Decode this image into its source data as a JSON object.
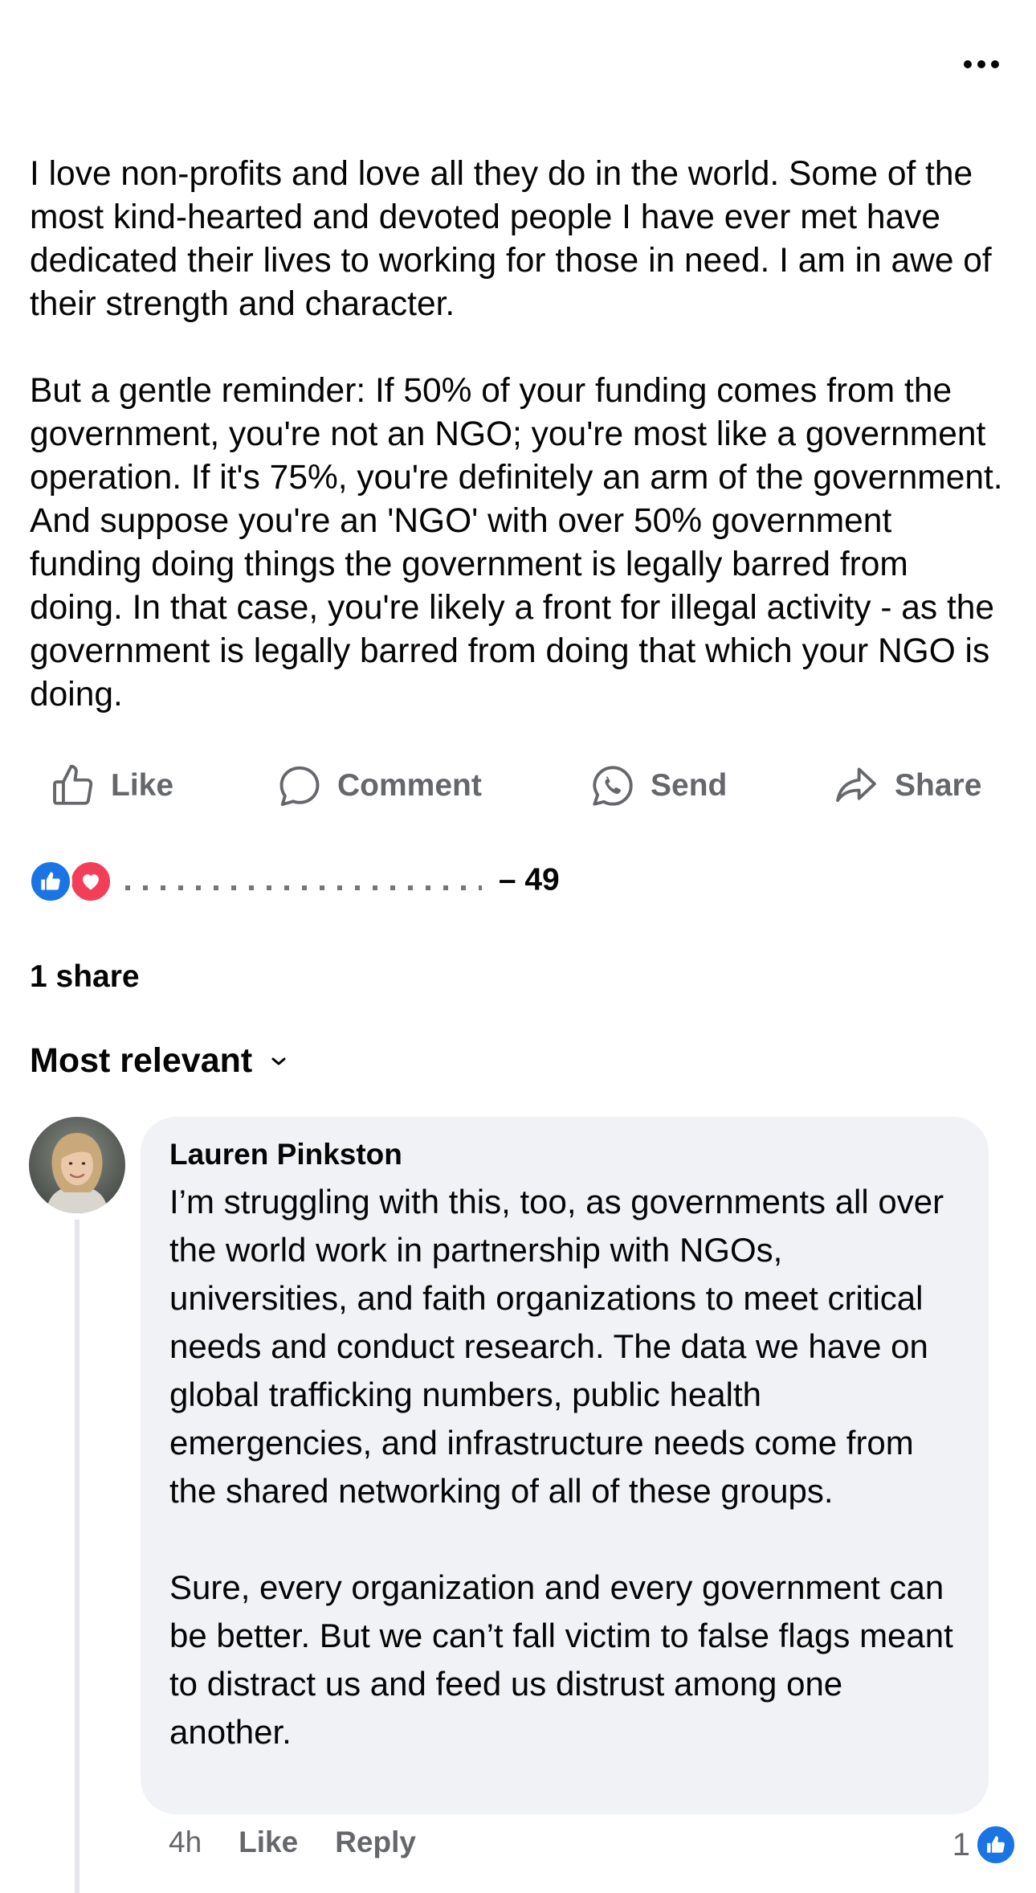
{
  "post": {
    "paragraphs": [
      "I love non-profits and love all they do in the world. Some of the most kind-hearted and devoted people I have ever met have dedicated their lives to working for those in need. I am in awe of their strength and character.",
      "But a gentle reminder: If 50% of your funding comes from the government, you're not an NGO; you're most like a government operation. If it's 75%, you're definitely an arm of the government. And suppose you're an 'NGO' with over 50% government funding doing things the government is legally barred from doing. In that case, you're likely a front for illegal activity - as the government is legally barred from doing that which your NGO is doing."
    ],
    "more_icon": "ellipsis-icon"
  },
  "actions": {
    "like": {
      "label": "Like",
      "icon": "thumbs-up-icon"
    },
    "comment": {
      "label": "Comment",
      "icon": "speech-bubble-icon"
    },
    "send": {
      "label": "Send",
      "icon": "messenger-whatsapp-icon"
    },
    "share": {
      "label": "Share",
      "icon": "share-arrow-icon"
    }
  },
  "reactions": {
    "types": [
      "like",
      "love"
    ],
    "names_suffix": "– 49",
    "like_color": "#1b74e4",
    "love_color": "#f33e58"
  },
  "shares": {
    "label": "1 share"
  },
  "comments_sort": {
    "label": "Most relevant"
  },
  "comment": {
    "author": "Lauren Pinkston",
    "paragraphs": [
      "I’m struggling with this, too, as governments all over the world work in partnership with NGOs, universities, and faith organizations to meet critical needs and conduct research. The data we have on global trafficking numbers, public health emergencies, and infrastructure needs come from the shared networking of all of these groups.",
      "Sure, every organization and every government can be better. But we can’t fall victim to false flags meant to distract us and feed us distrust among one another."
    ],
    "time": "4h",
    "like_label": "Like",
    "reply_label": "Reply",
    "reaction_count": "1"
  },
  "colors": {
    "text": "#050505",
    "secondary_text": "#65676b",
    "bubble": "#f0f2f5",
    "accent": "#1b74e4"
  }
}
